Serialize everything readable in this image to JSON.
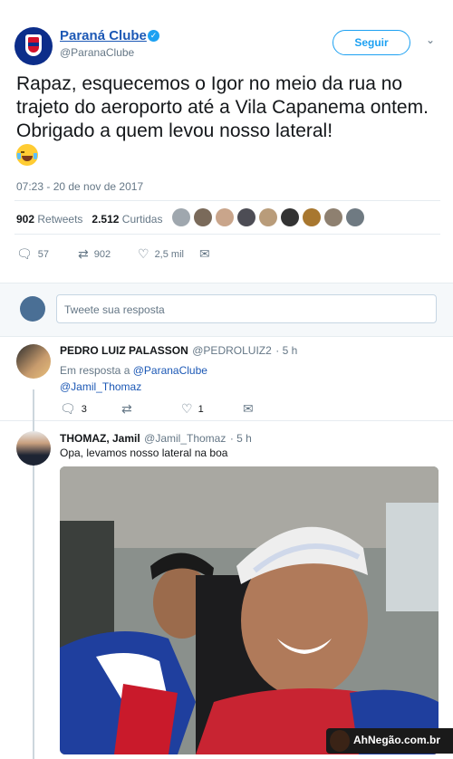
{
  "tweet": {
    "author_name": "Paraná Clube",
    "author_handle": "@ParanaClube",
    "follow_label": "Seguir",
    "text": "Rapaz, esquecemos o Igor no meio da rua no trajeto do aeroporto até a Vila Capanema ontem. Obrigado a quem levou nosso lateral!",
    "emoji": "face-with-tears-of-joy",
    "timestamp": "07:23 - 20 de nov de 2017",
    "retweets_count": "902",
    "retweets_label": "Retweets",
    "likes_count": "2.512",
    "likes_label": "Curtidas",
    "liker_count": 9,
    "actions": {
      "replies": "57",
      "retweets": "902",
      "likes": "2,5 mil"
    }
  },
  "reply_box": {
    "placeholder": "Tweete sua resposta"
  },
  "replies": [
    {
      "name": "PEDRO LUIZ PALASSON",
      "handle": "@PEDROLUIZ2",
      "time": "· 5 h",
      "in_reply_prefix": "Em resposta a",
      "in_reply_to": "@ParanaClube",
      "text": "@Jamil_Thomaz",
      "replies": "3",
      "retweets": "",
      "likes": "1"
    },
    {
      "name": "THOMAZ, Jamil",
      "handle": "@Jamil_Thomaz",
      "time": "· 5 h",
      "text": "Opa, levamos nosso lateral na boa"
    }
  ],
  "watermark": "AhNegão.com.br",
  "colors": {
    "link": "#1c58b5",
    "twitter_blue": "#1da1f2",
    "muted": "#657786"
  }
}
